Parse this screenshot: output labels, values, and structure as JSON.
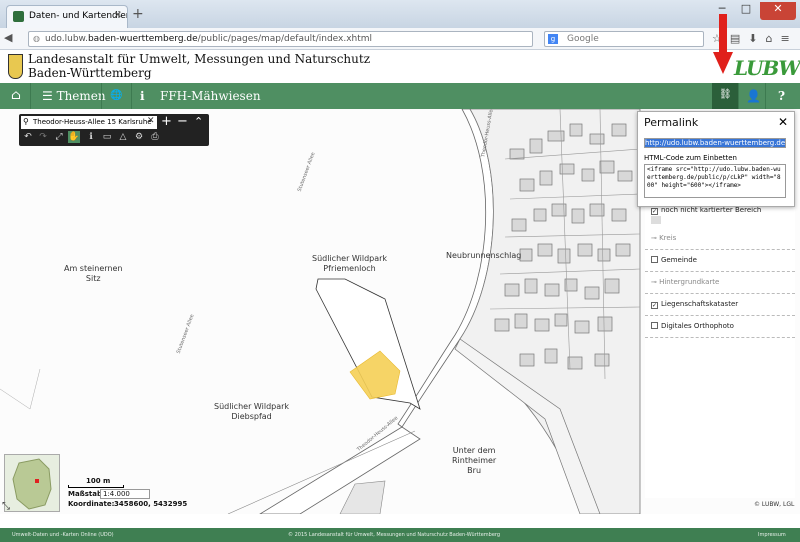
{
  "browser": {
    "tab_title": "Daten- und Kartendienst d...",
    "url_prefix": "udo.lubw.",
    "url_domain": "baden-wuerttemberg.de",
    "url_path": "/public/pages/map/default/index.xhtml",
    "search_placeholder": "Google",
    "window_buttons": [
      "─",
      "□",
      "✕"
    ]
  },
  "header": {
    "org_line1": "Landesanstalt für Umwelt, Messungen und Naturschutz",
    "org_line2": "Baden-Württemberg",
    "logo_text": "LUBW"
  },
  "toolbar": {
    "home_icon": "⌂",
    "themes_label": "Themen",
    "globe_icon": "🌐",
    "info_icon": "ℹ",
    "map_title": "FFH-Mähwiesen",
    "permalink_icon": "🔗",
    "user_icon": "👤",
    "help_icon": "?"
  },
  "map_tools": {
    "search_value": "Theodor-Heuss-Allee 15 Karlsruhe",
    "tools": [
      "↶",
      "↷",
      "⤢",
      "✋",
      "ℹ",
      "▭",
      "△",
      "⚙",
      "⎙"
    ],
    "zoom_in": "+",
    "zoom_out": "−",
    "collapse": "⌃"
  },
  "map": {
    "labels": [
      {
        "text": "Am steinernen\nSitz"
      },
      {
        "text": "Südlicher Wildpark\nPfriemenloch"
      },
      {
        "text": "Neubrunnenschlag"
      },
      {
        "text": "Südlicher Wildpark\nDiebspfad"
      },
      {
        "text": "Unter dem\nRintheimer\nBru"
      }
    ],
    "street_labels": [
      "Stutenseer Allee",
      "Stutenseer Allee",
      "Theodor-Heuss-Allee",
      "Theodor-Heuss-Allee"
    ],
    "copyright": "© LUBW, LGL"
  },
  "scale": {
    "bar_label": "100 m",
    "massstab_label": "Maßstab",
    "massstab_value": "1:4.000",
    "koordinate_label": "Koordinate:",
    "koordinate_value": "3458600, 5432995"
  },
  "permalink": {
    "title": "Permalink",
    "url": "http://udo.lubw.baden-wuerttemberg.de/public/p",
    "embed_label": "HTML-Code zum Einbetten",
    "embed_code": "<iframe src=\"http://udo.lubw.baden-wuerttemberg.de/public/p/cLkP\" width=\"800\" height=\"600\"></iframe>",
    "close_icon": "✕"
  },
  "layers": [
    {
      "label": "noch nicht kartierter Bereich",
      "checked": true,
      "dim": false
    },
    {
      "label": "Kreis",
      "checked": false,
      "dim": true,
      "group": true
    },
    {
      "label": "Gemeinde",
      "checked": false,
      "dim": false
    },
    {
      "label": "Hintergrundkarte",
      "checked": false,
      "dim": true,
      "group": true
    },
    {
      "label": "Liegenschaftskataster",
      "checked": true,
      "dim": false
    },
    {
      "label": "Digitales Orthophoto",
      "checked": false,
      "dim": false
    }
  ],
  "status": {
    "left": "Umwelt-Daten und -Karten Online (UDO)",
    "center": "© 2015 Landesanstalt für Umwelt, Messungen und Naturschutz Baden-Württemberg",
    "right": "Impressum"
  },
  "colors": {
    "toolbar_green": "#4f8f62",
    "habitat_fill": "#f5cf55",
    "arrow_red": "#e0201b"
  }
}
